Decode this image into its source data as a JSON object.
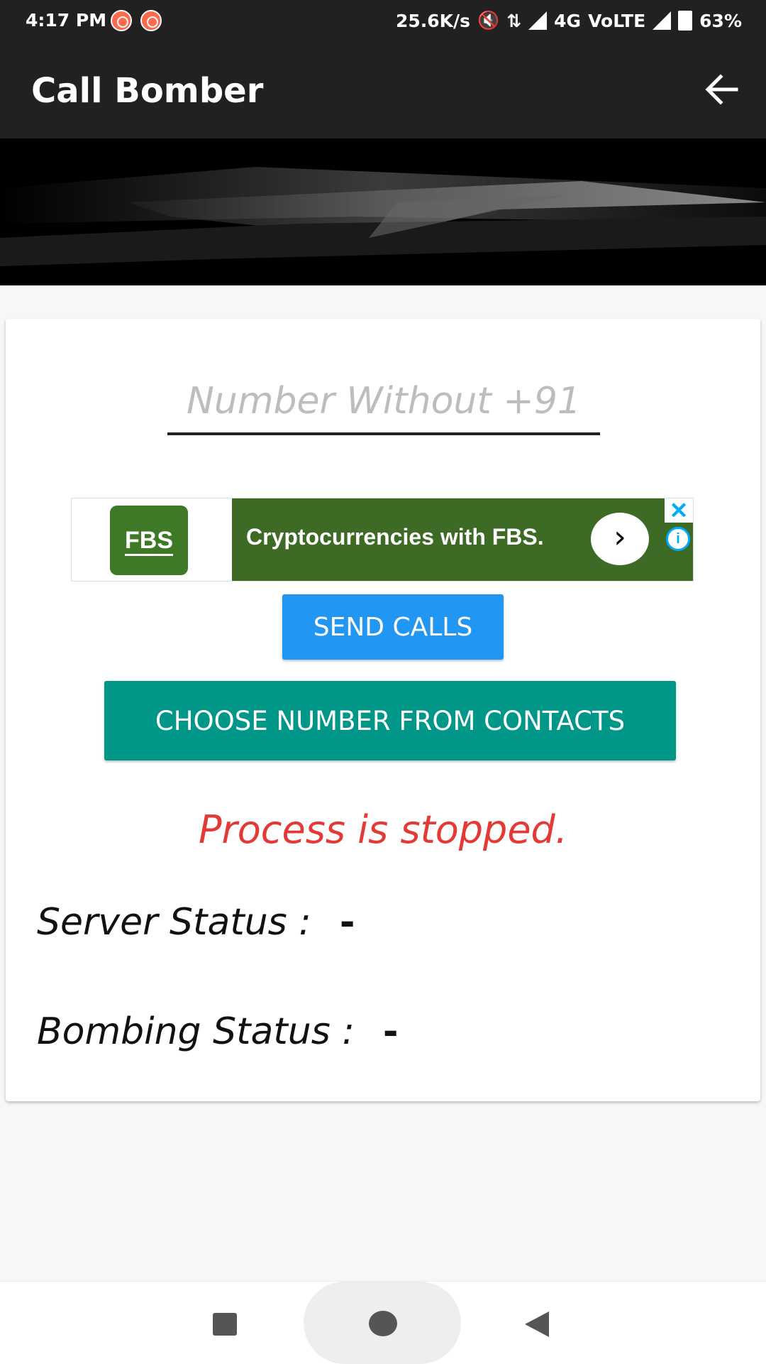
{
  "status_bar": {
    "time": "4:17 PM",
    "speed": "25.6K/s",
    "network": "4G",
    "volte": "VoLTE",
    "battery": "63%"
  },
  "app_bar": {
    "title": "Call Bomber"
  },
  "form": {
    "phone_placeholder": "Number Without +91",
    "send_button": "SEND CALLS",
    "contacts_button": "CHOOSE NUMBER FROM CONTACTS",
    "process_status": "Process is stopped."
  },
  "ad": {
    "logo_text": "FBS",
    "headline": "Cryptocurrencies with FBS.",
    "brand_color": "#3d6a24"
  },
  "server_status": {
    "label": "Server Status :",
    "value": "-"
  },
  "bombing_status": {
    "label": "Bombing Status :",
    "value": "-"
  },
  "colors": {
    "appbar": "#212121",
    "send_button": "#2196f3",
    "contacts_button": "#009688",
    "error_text": "#e53935"
  }
}
